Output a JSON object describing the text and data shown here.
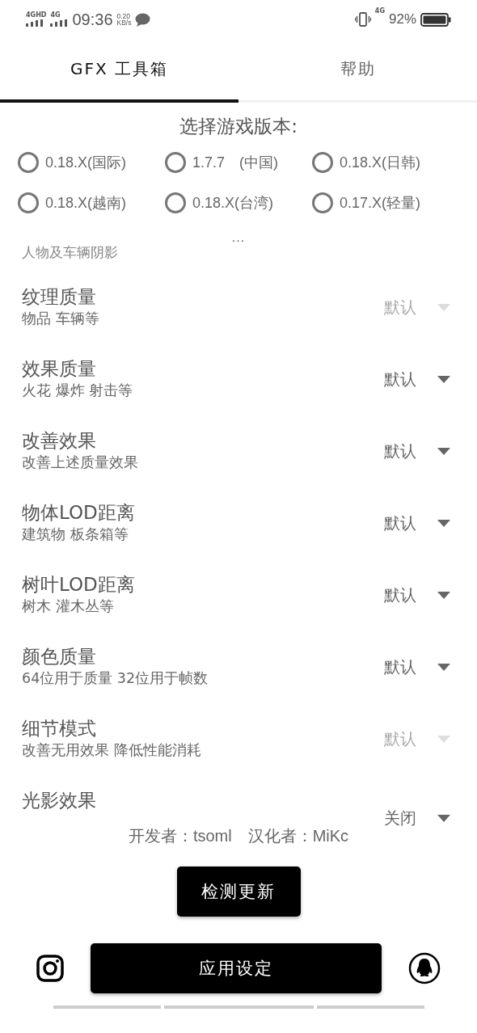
{
  "status_bar": {
    "network_1": "4GHD",
    "network_2": "4G",
    "time": "09:36",
    "speed_value": "0.20",
    "speed_unit": "KB/s",
    "data_network": "4G",
    "battery": "92%"
  },
  "tabs": [
    {
      "label": "GFX 工具箱",
      "selected": true
    },
    {
      "label": "帮助",
      "selected": false
    }
  ],
  "version_picker": {
    "title": "选择游戏版本:",
    "options": [
      {
        "label": "0.18.X(国际)",
        "selected": false
      },
      {
        "label": "1.7.7　(中国)",
        "selected": false
      },
      {
        "label": "0.18.X(日韩)",
        "selected": false
      },
      {
        "label": "0.18.X(越南)",
        "selected": false
      },
      {
        "label": "0.18.X(台湾)",
        "selected": false
      },
      {
        "label": "0.17.X(轻量)",
        "selected": false
      }
    ],
    "more": "..."
  },
  "settings": {
    "cut_description": "人物及车辆阴影",
    "items": [
      {
        "name": "纹理质量",
        "description": "物品 车辆等",
        "value": "默认",
        "disabled": true
      },
      {
        "name": "效果质量",
        "description": "火花 爆炸 射击等",
        "value": "默认",
        "disabled": false
      },
      {
        "name": "改善效果",
        "description": "改善上述质量效果",
        "value": "默认",
        "disabled": false
      },
      {
        "name": "物体LOD距离",
        "description": "建筑物 板条箱等",
        "value": "默认",
        "disabled": false
      },
      {
        "name": "树叶LOD距离",
        "description": "树木 灌木丛等",
        "value": "默认",
        "disabled": false
      },
      {
        "name": "颜色质量",
        "description": "64位用于质量 32位用于帧数",
        "value": "默认",
        "disabled": false
      },
      {
        "name": "细节模式",
        "description": "改善无用效果 降低性能消耗",
        "value": "默认",
        "disabled": true
      },
      {
        "name": "光影效果",
        "value": "关闭",
        "disabled": false
      }
    ]
  },
  "credits": "开发者：tsoml　汉化者：MiKc",
  "check_update_button": "检测更新",
  "apply_button": "应用设定"
}
